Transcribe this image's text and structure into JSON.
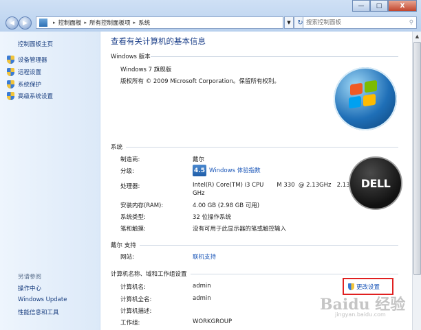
{
  "window": {
    "controls": {
      "minimize": "—",
      "maximize": "□",
      "close": "X"
    }
  },
  "address": {
    "breadcrumbs": [
      "控制面板",
      "所有控制面板项",
      "系统"
    ],
    "search_placeholder": "搜索控制面板"
  },
  "sidebar": {
    "home": "控制面板主页",
    "items": [
      {
        "label": "设备管理器",
        "icon": "shield-icon"
      },
      {
        "label": "远程设置",
        "icon": "shield-icon"
      },
      {
        "label": "系统保护",
        "icon": "shield-icon"
      },
      {
        "label": "高级系统设置",
        "icon": "shield-icon"
      }
    ],
    "see_also": "另请参阅",
    "links": [
      "操作中心",
      "Windows Update",
      "性能信息和工具"
    ]
  },
  "main": {
    "title": "查看有关计算机的基本信息",
    "edition": {
      "header": "Windows 版本",
      "name": "Windows 7 旗舰版",
      "copyright": "版权所有 © 2009 Microsoft Corporation。保留所有权利。"
    },
    "system": {
      "header": "系统",
      "manufacturer_label": "制造商:",
      "manufacturer_value": "戴尔",
      "rating_label": "分级:",
      "rating_score": "4.5",
      "rating_link": "Windows 体验指数",
      "processor_label": "处理器:",
      "processor_value": "Intel(R) Core(TM) i3 CPU       M 330  @ 2.13GHz   2.13",
      "processor_value2": "GHz",
      "ram_label": "安装内存(RAM):",
      "ram_value": "4.00 GB (2.98 GB 可用)",
      "type_label": "系统类型:",
      "type_value": "32 位操作系统",
      "pen_label": "笔和触摸:",
      "pen_value": "没有可用于此显示器的笔或触控输入"
    },
    "support": {
      "header": "戴尔 支持",
      "website_label": "网站:",
      "website_link": "联机支持"
    },
    "computer": {
      "header": "计算机名称、域和工作组设置",
      "name_label": "计算机名:",
      "name_value": "admin",
      "fullname_label": "计算机全名:",
      "fullname_value": "admin",
      "desc_label": "计算机描述:",
      "desc_value": "",
      "workgroup_label": "工作组:",
      "workgroup_value": "WORKGROUP",
      "change_link": "更改设置"
    },
    "dell_logo": "DELL"
  },
  "watermark": {
    "main": "Baidu 经验",
    "sub": "jingyan.baidu.com"
  },
  "colors": {
    "link": "#1a56b8",
    "title": "#1b3f89",
    "highlight_box": "#e02020"
  }
}
